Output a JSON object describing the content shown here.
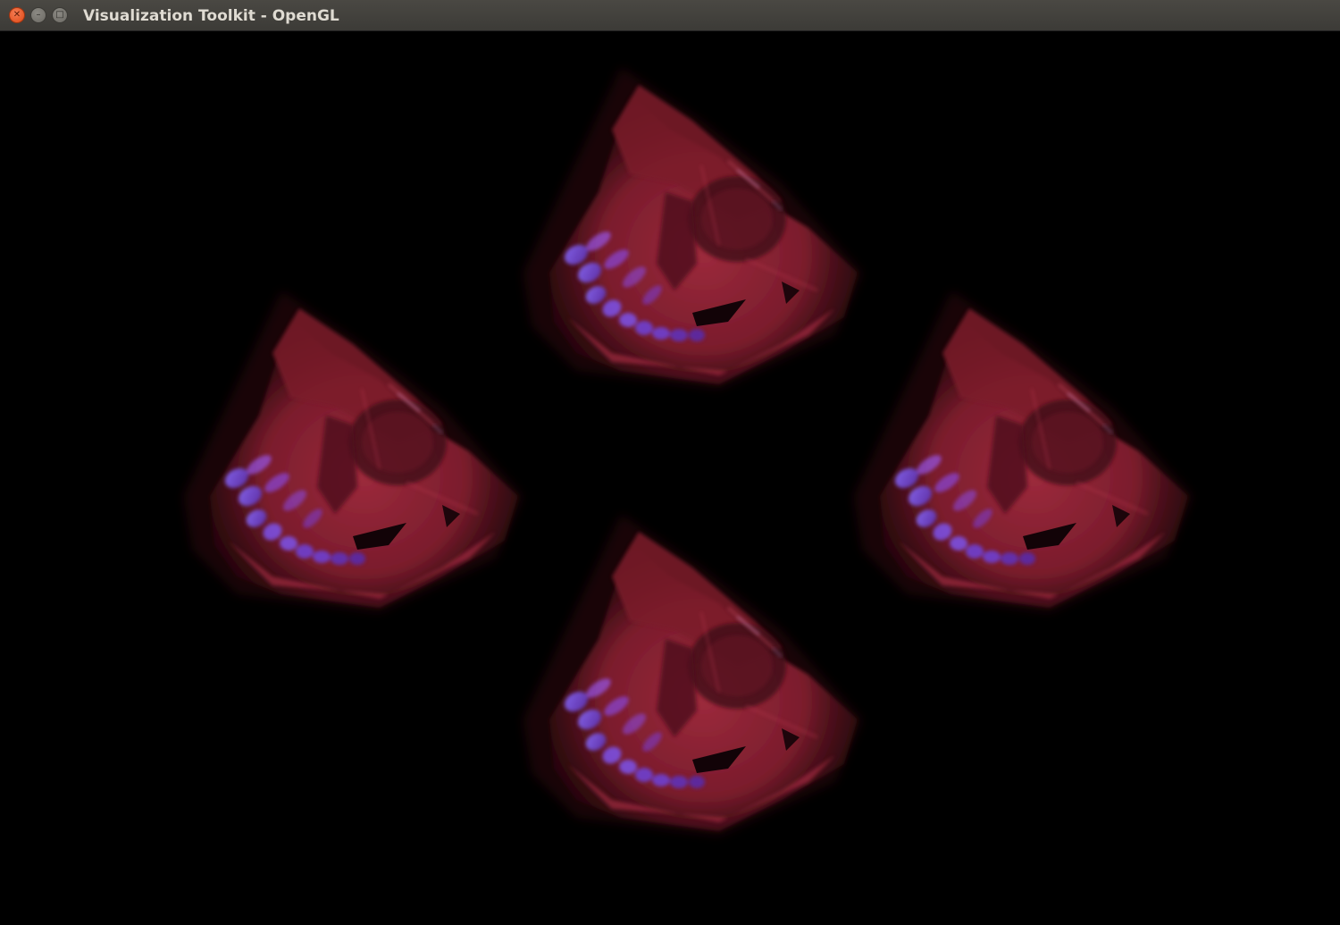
{
  "window": {
    "title": "Visualization Toolkit - OpenGL",
    "controls": {
      "close_icon": "close-icon",
      "minimize_icon": "minimize-icon",
      "maximize_icon": "maximize-icon"
    }
  },
  "viewport": {
    "background": "#000000",
    "render_count": 4,
    "render_subject": "volume-rendered skull",
    "colors": {
      "bone": "#8a1f2e",
      "bone_highlight": "#b8344a",
      "teeth": "#7a5cff"
    }
  }
}
